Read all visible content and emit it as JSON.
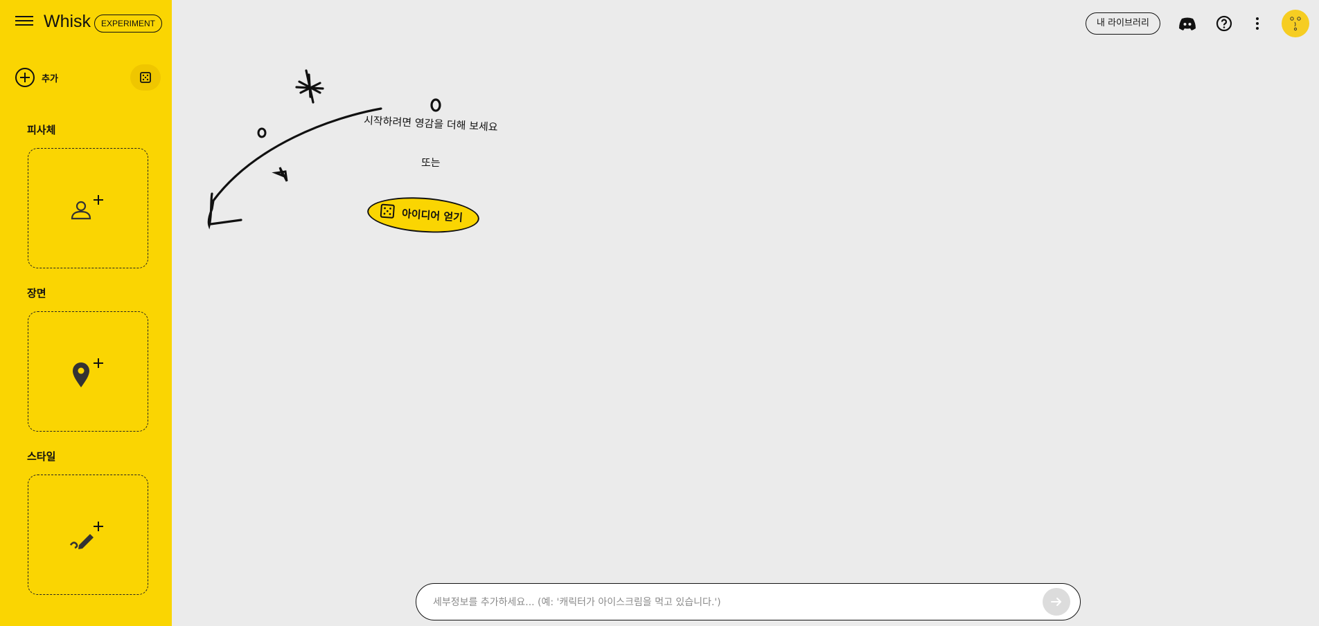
{
  "app": {
    "title": "Whisk",
    "badge": "EXPERIMENT"
  },
  "sidebar": {
    "add_label": "추가",
    "sections": [
      {
        "title": "피사체",
        "icon": "person-add-icon"
      },
      {
        "title": "장면",
        "icon": "location-add-icon"
      },
      {
        "title": "스타일",
        "icon": "brush-add-icon"
      }
    ]
  },
  "header": {
    "library_label": "내 라이브러리",
    "icons": [
      "discord-icon",
      "help-icon",
      "more-vert-icon",
      "avatar"
    ]
  },
  "canvas": {
    "hint": "시작하려면 영감을 더해 보세요",
    "or": "또는",
    "idea_button": "아이디어 얻기"
  },
  "prompt": {
    "placeholder": "세부정보를 추가하세요... (예: '캐릭터가 아이스크림을 먹고 있습니다.')",
    "value": ""
  },
  "colors": {
    "accent": "#fad502",
    "background": "#ebebeb"
  }
}
